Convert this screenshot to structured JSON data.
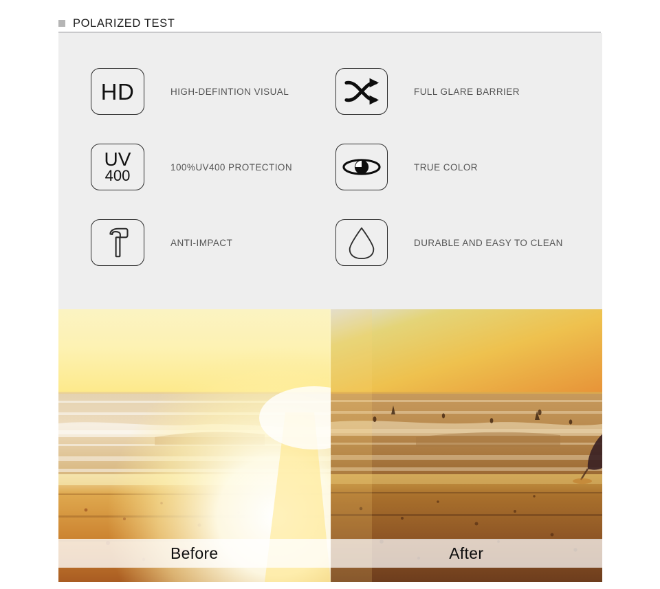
{
  "header": {
    "title": "POLARIZED TEST",
    "bullet_color": "#b5b5b5",
    "rule_color": "#c9c9cb"
  },
  "panel": {
    "background_color": "#eeeeee",
    "features": [
      {
        "icon": "hd-badge-icon",
        "icon_text_primary": "HD",
        "icon_text_secondary": "",
        "label": "HIGH-DEFINTION VISUAL"
      },
      {
        "icon": "shuffle-arrows-icon",
        "icon_text_primary": "",
        "icon_text_secondary": "",
        "label": "FULL GLARE BARRIER"
      },
      {
        "icon": "uv400-badge-icon",
        "icon_text_primary": "UV",
        "icon_text_secondary": "400",
        "label": "100%UV400 PROTECTION"
      },
      {
        "icon": "eye-icon",
        "icon_text_primary": "",
        "icon_text_secondary": "",
        "label": "TRUE COLOR"
      },
      {
        "icon": "hammer-icon",
        "icon_text_primary": "",
        "icon_text_secondary": "",
        "label": "ANTI-IMPACT"
      },
      {
        "icon": "water-droplet-icon",
        "icon_text_primary": "",
        "icon_text_secondary": "",
        "label": "DURABLE AND EASY TO CLEAN"
      }
    ]
  },
  "photo": {
    "alt_name": "beach-sunset-comparison",
    "caption_before": "Before",
    "caption_after": "After",
    "colors": {
      "sky_left_top": "#fdf7cf",
      "sky_left_bright": "#ffffff",
      "sky_right_top": "#e9c95a",
      "sky_right_warm": "#e79a3c",
      "sand_left": "#d9862f",
      "sand_right": "#9e5a28",
      "sea_left": "#e8d7b8",
      "sea_right": "#b98a4e"
    }
  }
}
